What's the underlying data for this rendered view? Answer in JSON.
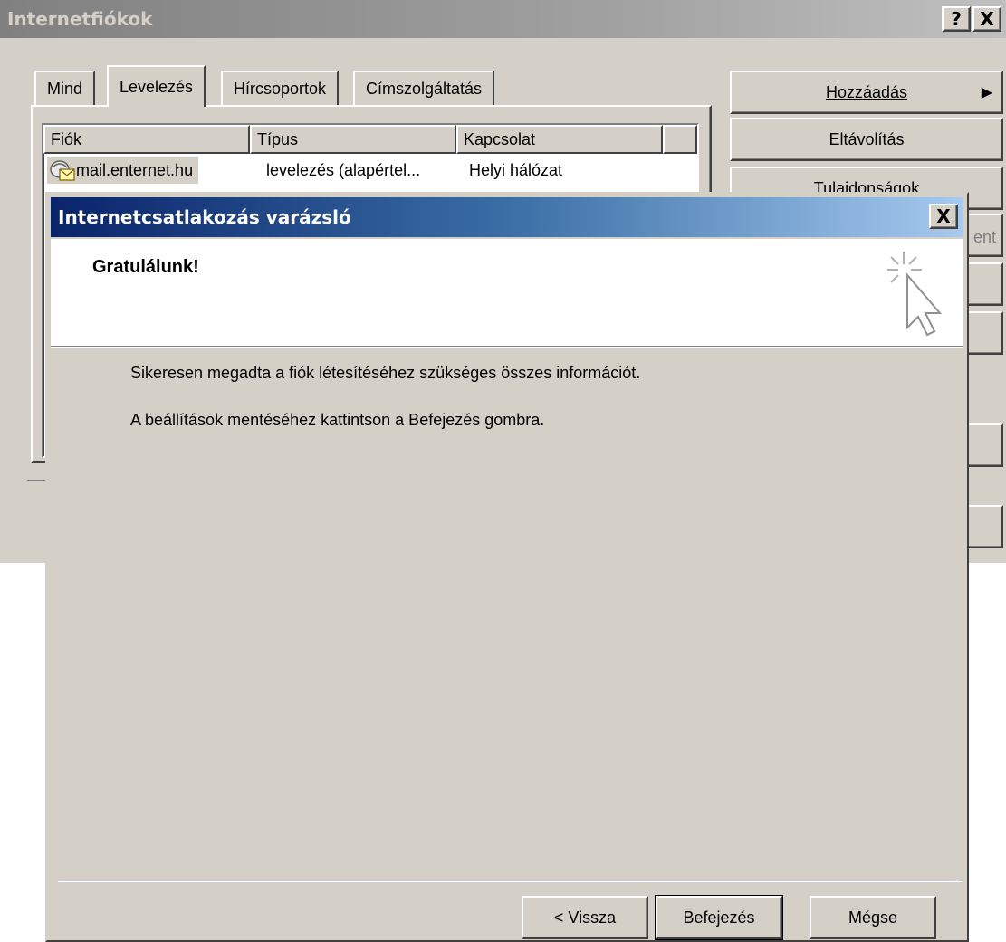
{
  "back_window": {
    "title": "Internetfiókok",
    "help_button": "?",
    "close_button": "X",
    "tabs": [
      {
        "label": "Mind",
        "active": false
      },
      {
        "label": "Levelezés",
        "active": true
      },
      {
        "label": "Hírcsoportok",
        "active": false
      },
      {
        "label": "Címszolgáltatás",
        "active": false
      }
    ],
    "columns": [
      "Fiók",
      "Típus",
      "Kapcsolat"
    ],
    "rows": [
      {
        "account": "mail.enternet.hu",
        "type": "levelezés (alapértel...",
        "connection": "Helyi hálózat",
        "icon": "mail-account-icon"
      }
    ],
    "buttons": {
      "add": "Hozzáadás",
      "remove": "Eltávolítás",
      "properties": "Tulajdonságok",
      "partial_label": "ent"
    }
  },
  "wizard": {
    "title": "Internetcsatlakozás varázsló",
    "close_button": "X",
    "heading": "Gratulálunk!",
    "icon": "wizard-cursor-sparkle-icon",
    "body_line1": "Sikeresen megadta a fiók létesítéséhez szükséges összes információt.",
    "body_line2": "A beállítások mentéséhez kattintson a Befejezés gombra.",
    "buttons": {
      "back": "< Vissza",
      "finish": "Befejezés",
      "cancel": "Mégse"
    }
  },
  "colors": {
    "dialog_face": "#d4d0c8",
    "active_title_start": "#0a246a",
    "active_title_end": "#a6caf0",
    "inactive_title": "#808080"
  }
}
